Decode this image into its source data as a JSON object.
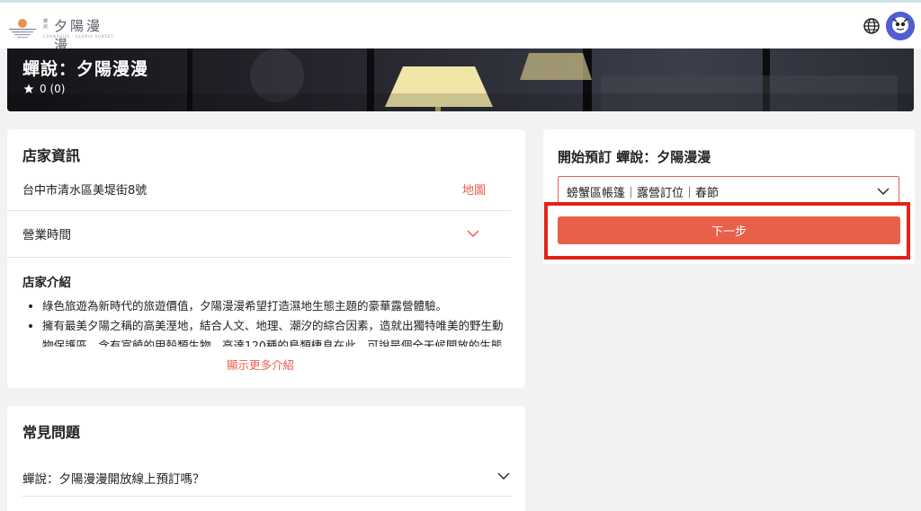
{
  "header": {
    "logo_small": "蟬說",
    "logo_title": "夕陽漫漫",
    "logo_subtitle": "CHANSHUO · GLORIA SUNSET",
    "globe_icon": "globe-icon",
    "avatar_icon": "avatar-icon"
  },
  "hero": {
    "title": "蟬說：夕陽漫漫",
    "rating_text": "0 (0)"
  },
  "store_info": {
    "heading": "店家資訊",
    "address": "台中市清水區美堤街8號",
    "map_link": "地圖",
    "hours_label": "營業時間",
    "intro_heading": "店家介紹",
    "intro_items": [
      "綠色旅遊為新時代的旅遊價值，夕陽漫漫希望打造濕地生態主題的豪華露營體驗。",
      "擁有最美夕陽之稱的高美溼地，結合人文、地理、潮汐的綜合因素，造就出獨特唯美的野生動物保護區。含有富饒的甲殼類生物，高達120種的鳥類棲息在此，可說是個全天候開放的生態博"
    ],
    "show_more": "顯示更多介紹"
  },
  "faq": {
    "heading": "常見問題",
    "items": [
      "蟬說：夕陽漫漫開放線上預訂嗎？"
    ]
  },
  "booking": {
    "heading": "開始預訂 蟬說：夕陽漫漫",
    "selected_option": "螃蟹區帳篷｜露營訂位｜春節",
    "next_button": "下一步"
  },
  "colors": {
    "accent": "#e9604a",
    "highlight_border": "#e2231a",
    "avatar_bg": "#4f5fd0"
  }
}
